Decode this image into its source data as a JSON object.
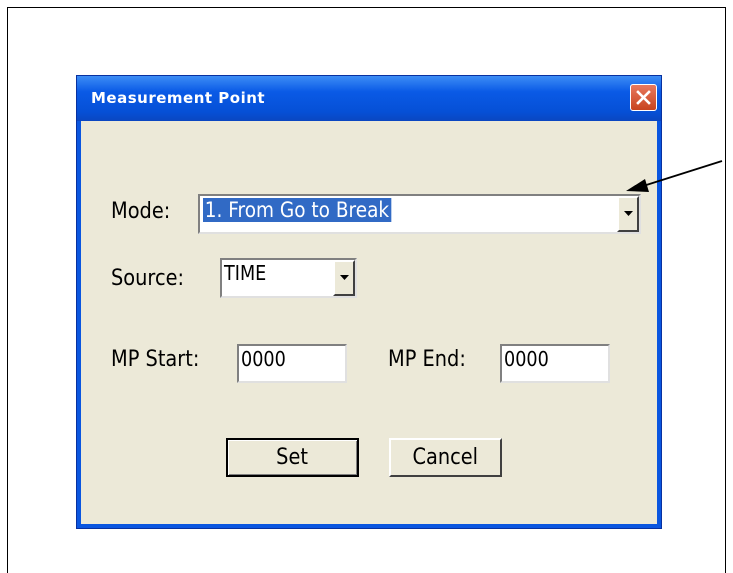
{
  "window": {
    "title": "Measurement Point"
  },
  "form": {
    "mode_label": "Mode:",
    "mode_value": "1. From Go to Break",
    "source_label": "Source:",
    "source_value": "TIME",
    "mp_start_label": "MP Start:",
    "mp_start_value": "0000",
    "mp_end_label": "MP End:",
    "mp_end_value": "0000"
  },
  "buttons": {
    "set_label": "Set",
    "cancel_label": "Cancel"
  },
  "colors": {
    "titlebar": "#0a5ae6",
    "client": "#ece9d8",
    "selection": "#316ac5",
    "close": "#c8431e"
  },
  "icons": {
    "close": "close-icon",
    "dropdown": "chevron-down-icon",
    "callout": "arrow-icon"
  }
}
